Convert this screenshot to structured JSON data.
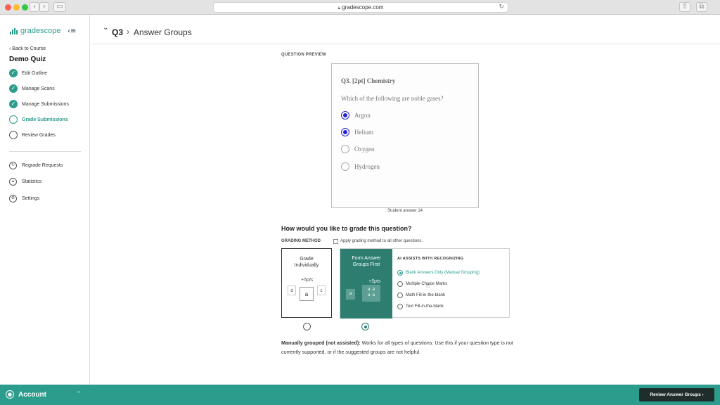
{
  "browser": {
    "url": "gradescope.com",
    "back_icon": "chevron-left-icon",
    "forward_icon": "chevron-right-icon"
  },
  "sidebar": {
    "logo_text": "gradescope",
    "collapse_icon": "collapse-menu-icon",
    "back_link": "‹ Back to Course",
    "course_title": "Demo Quiz",
    "steps": [
      {
        "label": "Edit Outline",
        "status": "done"
      },
      {
        "label": "Manage Scans",
        "status": "done"
      },
      {
        "label": "Manage Submissions",
        "status": "done"
      },
      {
        "label": "Grade Submissions",
        "status": "current"
      },
      {
        "label": "Review Grades",
        "status": "todo"
      }
    ],
    "tools": [
      {
        "label": "Regrade Requests",
        "icon": "regrade-icon"
      },
      {
        "label": "Statistics",
        "icon": "statistics-icon"
      },
      {
        "label": "Settings",
        "icon": "gear-icon"
      }
    ]
  },
  "header": {
    "question": "Q3",
    "separator": "›",
    "title": "Answer Groups"
  },
  "preview": {
    "section_label": "QUESTION PREVIEW",
    "question_title": "Q3. [2pt] Chemistry",
    "question_text": "Which of the following are noble gases?",
    "options": [
      {
        "label": "Argon",
        "marked": true
      },
      {
        "label": "Helium",
        "marked": true
      },
      {
        "label": "Oxygen",
        "marked": false
      },
      {
        "label": "Hydrogen",
        "marked": false
      }
    ],
    "caption": "Student answer 14"
  },
  "grading": {
    "question": "How would you like to grade this question?",
    "method_label": "GRADING METHOD",
    "apply_label": "Apply grading method to all other questions.",
    "apply_checked": false,
    "individual": {
      "label_line1": "Grade",
      "label_line2": "Individually",
      "scribble": "+5pts",
      "boxes": [
        "d",
        "a",
        "c"
      ]
    },
    "groups": {
      "label_line1": "Form Answer",
      "label_line2": "Groups First",
      "scribble": "+5pts",
      "boxes": [
        "a",
        "a",
        "a",
        "a",
        "a"
      ]
    },
    "ai_title": "AI ASSISTS WITH RECOGNIZING",
    "ai_options": [
      {
        "label": "Blank Answers Only (Manual Grouping)",
        "selected": true
      },
      {
        "label": "Multiple Choice Marks",
        "selected": false
      },
      {
        "label": "Math Fill-in-the-blank",
        "selected": false
      },
      {
        "label": "Text Fill-in-the-blank",
        "selected": false
      }
    ],
    "selected_method": "groups",
    "description_bold": "Manually grouped (not assisted):",
    "description_text": " Works for all types of questions. Use this if your question type is not currently supported, or if the suggested groups are not helpful."
  },
  "footer": {
    "account_label": "Account",
    "account_caret": "^",
    "review_button": "Review Answer Groups ›"
  },
  "colors": {
    "brand_teal": "#2c9c8d",
    "dark_teal": "#2d7e71",
    "mark_blue": "#2623c9",
    "button_dark": "#1f2e2b"
  }
}
